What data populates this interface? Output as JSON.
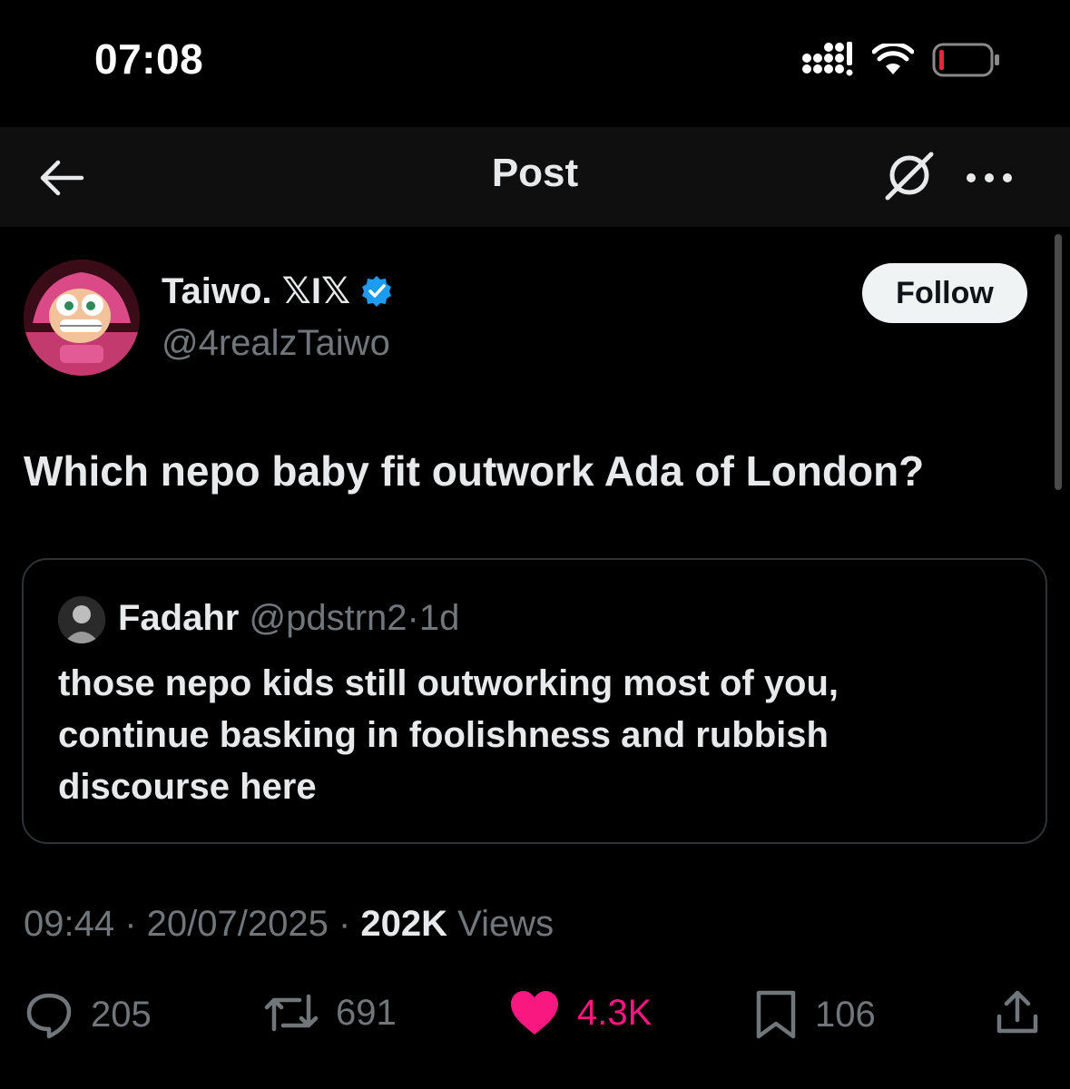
{
  "status_bar": {
    "time": "07:08"
  },
  "header": {
    "title": "Post"
  },
  "author": {
    "display_name": "Taiwo. 𝕏I𝕏",
    "handle": "@4realzTaiwo",
    "verified": true,
    "follow_label": "Follow"
  },
  "post": {
    "text": "Which nepo baby fit outwork Ada of London?"
  },
  "quoted_post": {
    "display_name": "Fadahr",
    "handle": "@pdstrn2",
    "age": "1d",
    "text_lines": [
      "those nepo kids still outworking most of you,",
      "continue basking in foolishness and rubbish",
      "discourse here"
    ]
  },
  "post_meta": {
    "time": "09:44",
    "date": "20/07/2025",
    "views_count": "202K",
    "views_label": "Views"
  },
  "actions": {
    "replies": "205",
    "reposts": "691",
    "likes": "4.3K",
    "bookmarks": "106"
  },
  "colors": {
    "background": "#000000",
    "header_bg": "#0f0f0f",
    "text_primary": "#e7e9ea",
    "text_secondary": "#71767b",
    "like_pink": "#f91880",
    "verified_blue": "#1d9bf0",
    "battery_low": "#e0293a"
  }
}
